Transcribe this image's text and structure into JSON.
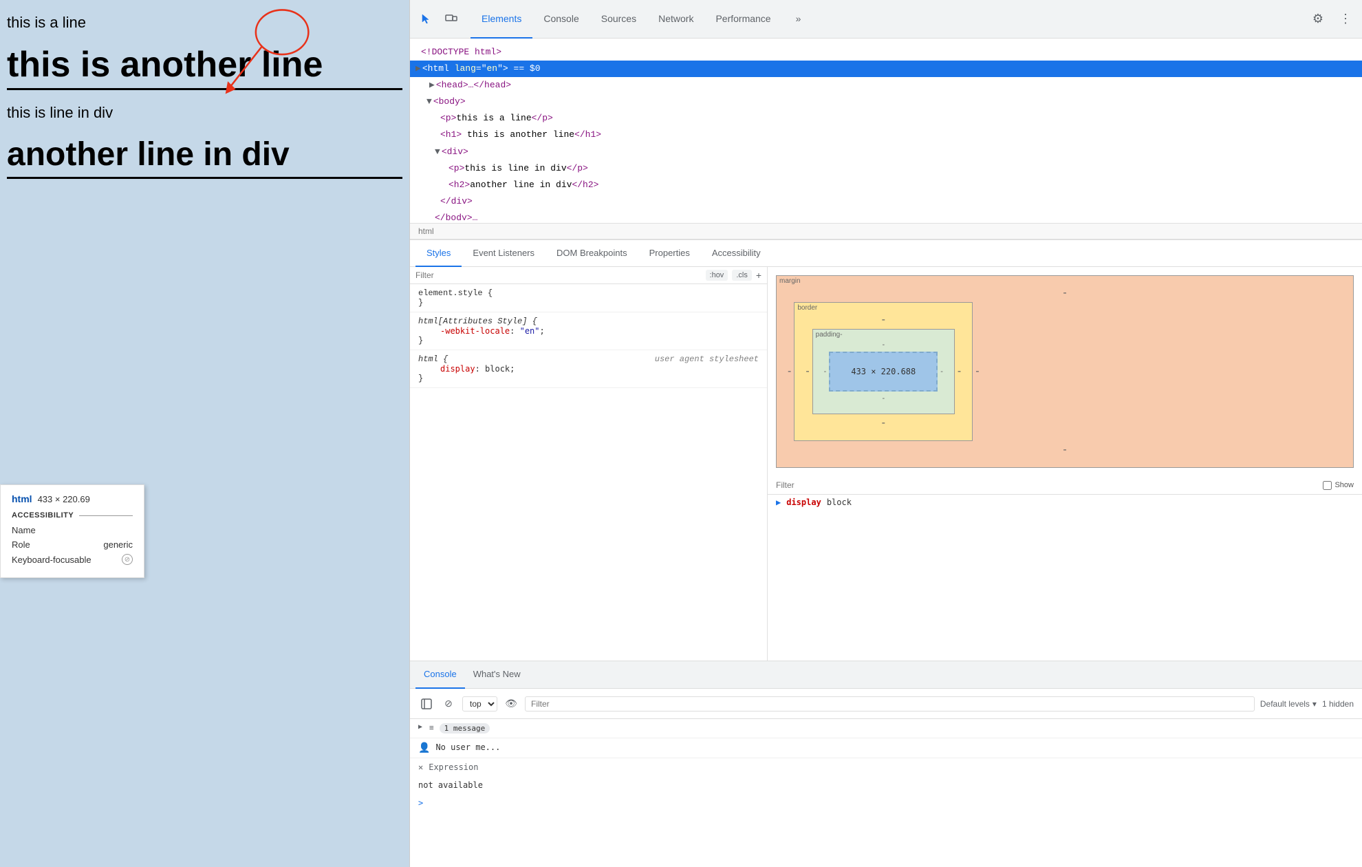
{
  "webpage": {
    "line1": "this is a line",
    "line2": "this is another line",
    "line3": "this is line in div",
    "line4": "another line in div"
  },
  "a11y": {
    "element_tag": "html",
    "element_size": "433 × 220.69",
    "title": "ACCESSIBILITY",
    "name_label": "Name",
    "name_value": "",
    "role_label": "Role",
    "role_value": "generic",
    "keyboard_label": "Keyboard-focusable",
    "keyboard_icon": "⊘"
  },
  "devtools": {
    "tabs": [
      {
        "label": "Elements",
        "active": true
      },
      {
        "label": "Console",
        "active": false
      },
      {
        "label": "Sources",
        "active": false
      },
      {
        "label": "Network",
        "active": false
      },
      {
        "label": "Performance",
        "active": false
      }
    ],
    "more_icon": "»",
    "settings_icon": "⚙",
    "menu_icon": "⋮"
  },
  "dom": {
    "breadcrumb": "html",
    "lines": [
      {
        "indent": 0,
        "toggle": "",
        "content": "<!DOCTYPE html>",
        "type": "doctype"
      },
      {
        "indent": 0,
        "toggle": "▶",
        "content": "<html lang=\"en\"> == $0",
        "type": "selected"
      },
      {
        "indent": 1,
        "toggle": "▶",
        "content": "<head>…</head>",
        "type": "collapsed"
      },
      {
        "indent": 1,
        "toggle": "▼",
        "content": "<body>",
        "type": "open"
      },
      {
        "indent": 2,
        "toggle": "",
        "content": "<p>this is a line</p>",
        "type": "leaf"
      },
      {
        "indent": 2,
        "toggle": "",
        "content": "<h1> this is another line</h1>",
        "type": "leaf"
      },
      {
        "indent": 2,
        "toggle": "▼",
        "content": "<div>",
        "type": "open"
      },
      {
        "indent": 3,
        "toggle": "",
        "content": "<p>this is line in div</p>",
        "type": "leaf"
      },
      {
        "indent": 3,
        "toggle": "",
        "content": "<h2>another line in div</h2>",
        "type": "leaf"
      },
      {
        "indent": 2,
        "toggle": "",
        "content": "</div>",
        "type": "close"
      },
      {
        "indent": 2,
        "toggle": "",
        "content": "</body>…",
        "type": "partial"
      }
    ]
  },
  "panel_tabs": [
    {
      "label": "Styles",
      "active": true
    },
    {
      "label": "Event Listeners",
      "active": false
    },
    {
      "label": "DOM Breakpoints",
      "active": false
    },
    {
      "label": "Properties",
      "active": false
    },
    {
      "label": "Accessibility",
      "active": false
    }
  ],
  "styles": {
    "filter_placeholder": "Filter",
    "hov_badge": ":hov",
    "cls_badge": ".cls",
    "add_icon": "+",
    "rules": [
      {
        "selector": "element.style {",
        "properties": [],
        "close": "}"
      },
      {
        "selector": "html[Attributes Style] {",
        "properties": [
          {
            "name": "-webkit-locale",
            "value": "\"en\";"
          }
        ],
        "close": "}"
      },
      {
        "selector": "html {",
        "comment": "user agent stylesheet",
        "properties": [
          {
            "name": "display",
            "value": "block;"
          }
        ],
        "close": "}"
      }
    ]
  },
  "box_model": {
    "margin_label": "margin",
    "margin_dash": "-",
    "border_label": "border",
    "border_dash": "-",
    "padding_label": "padding-",
    "content_size": "433 × 220.688",
    "side_dash": "-"
  },
  "computed": {
    "filter_placeholder": "Filter",
    "show_label": "Show",
    "display_prop": "display",
    "display_val": "block"
  },
  "console": {
    "tabs": [
      {
        "label": "Console",
        "active": true
      },
      {
        "label": "What's New",
        "active": false
      }
    ],
    "top_label": "top",
    "filter_placeholder": "Filter",
    "levels_label": "Default levels",
    "hidden_count": "1 hidden",
    "messages": [
      {
        "type": "list",
        "count": "1 message",
        "text": ""
      }
    ],
    "user_msg": "No user me...",
    "expression_label": "Expression",
    "expression_text": "not available",
    "gt": ">"
  }
}
